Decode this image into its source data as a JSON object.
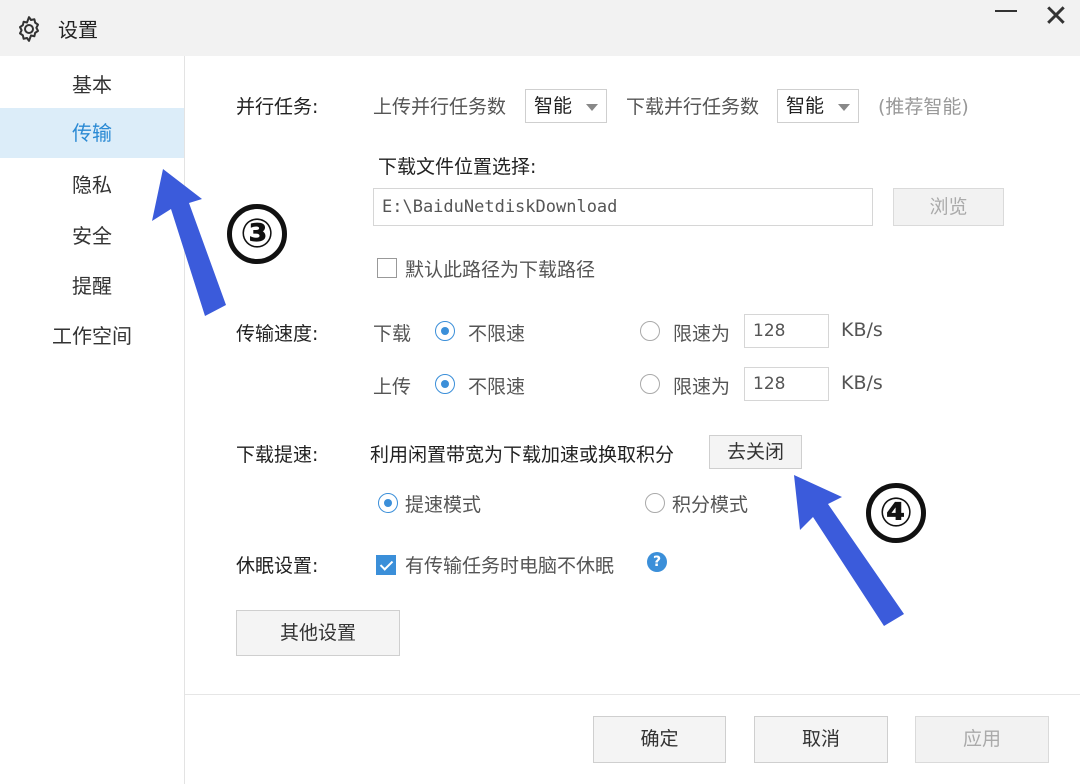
{
  "window": {
    "title": "设置",
    "icon": "gear-icon",
    "minimize_icon": "minimize-icon",
    "close_icon": "close-icon",
    "close_glyph": "✕"
  },
  "sidebar": {
    "items": [
      {
        "label": "基本",
        "active": false
      },
      {
        "label": "传输",
        "active": true
      },
      {
        "label": "隐私",
        "active": false
      },
      {
        "label": "安全",
        "active": false
      },
      {
        "label": "提醒",
        "active": false
      },
      {
        "label": "工作空间",
        "active": false
      }
    ]
  },
  "parallel": {
    "label": "并行任务:",
    "upload_label": "上传并行任务数",
    "upload_value": "智能",
    "download_label": "下载并行任务数",
    "download_value": "智能",
    "hint": "(推荐智能)"
  },
  "download_location": {
    "label": "下载文件位置选择:",
    "path": "E:\\BaiduNetdiskDownload",
    "browse_label": "浏览",
    "default_checkbox_label": "默认此路径为下载路径",
    "default_checked": false
  },
  "speed": {
    "label": "传输速度:",
    "download": {
      "label": "下载",
      "unlimited_label": "不限速",
      "limit_label": "限速为",
      "limit_value": "128",
      "unit": "KB/s",
      "unlimited_selected": true
    },
    "upload": {
      "label": "上传",
      "unlimited_label": "不限速",
      "limit_label": "限速为",
      "limit_value": "128",
      "unit": "KB/s",
      "unlimited_selected": true
    }
  },
  "accelerate": {
    "label": "下载提速:",
    "desc": "利用闲置带宽为下载加速或换取积分",
    "button_label": "去关闭",
    "mode_speed_label": "提速模式",
    "mode_points_label": "积分模式",
    "speed_mode_selected": true
  },
  "sleep": {
    "label": "休眠设置:",
    "checkbox_label": "有传输任务时电脑不休眠",
    "checked": true,
    "help_icon": "help-icon",
    "help_glyph": "?"
  },
  "other_settings_label": "其他设置",
  "footer": {
    "ok_label": "确定",
    "cancel_label": "取消",
    "apply_label": "应用"
  },
  "annotations": {
    "step3": "③",
    "step4": "④",
    "arrow_color": "#3b5bdb"
  },
  "colors": {
    "accent": "#3b8fd9",
    "sidebar_active_bg": "#dcedf9"
  }
}
